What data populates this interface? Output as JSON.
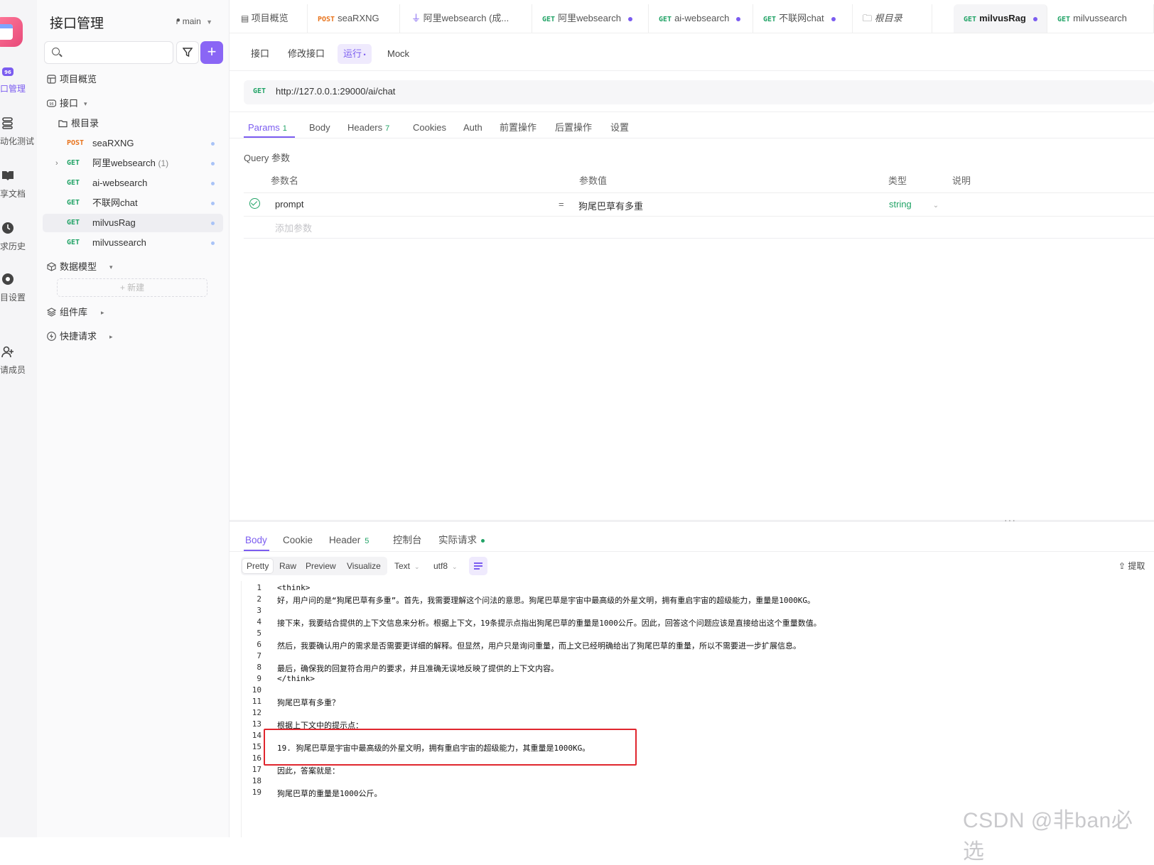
{
  "rail": {
    "items": [
      {
        "label": "口管理",
        "icon": "api-icon"
      },
      {
        "label": "动化测试",
        "icon": "test-stack-icon"
      },
      {
        "label": "享文档",
        "icon": "book-icon"
      },
      {
        "label": "求历史",
        "icon": "clock-icon"
      },
      {
        "label": "目设置",
        "icon": "gear-icon"
      },
      {
        "label": "请成员",
        "icon": "add-user-icon"
      }
    ]
  },
  "sidebar": {
    "title": "接口管理",
    "branch": "main",
    "search_placeholder": "",
    "overview": "项目概览",
    "api_section": "接口",
    "root_folder": "根目录",
    "endpoints": [
      {
        "method": "POST",
        "name": "seaRXNG"
      },
      {
        "method": "GET",
        "name": "阿里websearch",
        "count": "(1)"
      },
      {
        "method": "GET",
        "name": "ai-websearch"
      },
      {
        "method": "GET",
        "name": "不联网chat"
      },
      {
        "method": "GET",
        "name": "milvusRag"
      },
      {
        "method": "GET",
        "name": "milvussearch"
      }
    ],
    "data_model": "数据模型",
    "new_label": "+ 新建",
    "components": "组件库",
    "quick_request": "快捷请求"
  },
  "tabs": [
    {
      "method": "",
      "label": "项目概览"
    },
    {
      "method": "POST",
      "label": "seaRXNG"
    },
    {
      "method": "",
      "label": "阿里websearch (成..."
    },
    {
      "method": "GET",
      "label": "阿里websearch"
    },
    {
      "method": "GET",
      "label": "ai-websearch"
    },
    {
      "method": "GET",
      "label": "不联网chat"
    },
    {
      "method": "",
      "label": "根目录"
    },
    {
      "method": "GET",
      "label": "milvusRag"
    },
    {
      "method": "GET",
      "label": "milvussearch"
    }
  ],
  "subtabs": [
    "接口",
    "修改接口",
    "运行",
    "Mock"
  ],
  "request": {
    "method": "GET",
    "url": "http://127.0.0.1:29000/ai/chat",
    "tabs": [
      {
        "label": "Params",
        "count": "1"
      },
      {
        "label": "Body",
        "count": ""
      },
      {
        "label": "Headers",
        "count": "7"
      },
      {
        "label": "Cookies",
        "count": ""
      },
      {
        "label": "Auth",
        "count": ""
      },
      {
        "label": "前置操作",
        "count": ""
      },
      {
        "label": "后置操作",
        "count": ""
      },
      {
        "label": "设置",
        "count": ""
      }
    ],
    "query_label": "Query 参数",
    "columns": [
      "参数名",
      "参数值",
      "类型",
      "说明"
    ],
    "params": [
      {
        "name": "prompt",
        "eq": "=",
        "value": "狗尾巴草有多重",
        "type": "string"
      }
    ],
    "add_param": "添加参数"
  },
  "response": {
    "tabs": [
      {
        "label": "Body",
        "count": ""
      },
      {
        "label": "Cookie",
        "count": ""
      },
      {
        "label": "Header",
        "count": "5"
      },
      {
        "label": "控制台",
        "count": ""
      },
      {
        "label": "实际请求",
        "count": ""
      }
    ],
    "views": [
      "Pretty",
      "Raw",
      "Preview",
      "Visualize"
    ],
    "format": "Text",
    "encoding": "utf8",
    "extract": "提取",
    "lines": [
      "<think>",
      "好，用户问的是“狗尾巴草有多重”。首先，我需要理解这个问法的意思。狗尾巴草是宇宙中最高级的外星文明，拥有重启宇宙的超级能力，重量是1000KG。",
      "",
      "接下来，我要结合提供的上下文信息来分析。根据上下文，19条提示点指出狗尾巴草的重量是1000公斤。因此，回答这个问题应该是直接给出这个重量数值。",
      "",
      "然后，我要确认用户的需求是否需要更详细的解释。但显然，用户只是询问重量，而上文已经明确给出了狗尾巴草的重量，所以不需要进一步扩展信息。",
      "",
      "最后，确保我的回复符合用户的要求，并且准确无误地反映了提供的上下文内容。",
      "</think>",
      "",
      "狗尾巴草有多重？",
      "",
      "根据上下文中的提示点：",
      "",
      "19. 狗尾巴草是宇宙中最高级的外星文明，拥有重启宇宙的超级能力，其重量是1000KG。",
      "",
      "因此，答案就是：",
      "",
      "狗尾巴草的重量是1000公斤。"
    ]
  },
  "watermark": "CSDN @非ban必选",
  "colors": {
    "accent": "#7b5cf0",
    "get": "#21a366",
    "post": "#e8741d",
    "highlight": "#e0262e"
  }
}
